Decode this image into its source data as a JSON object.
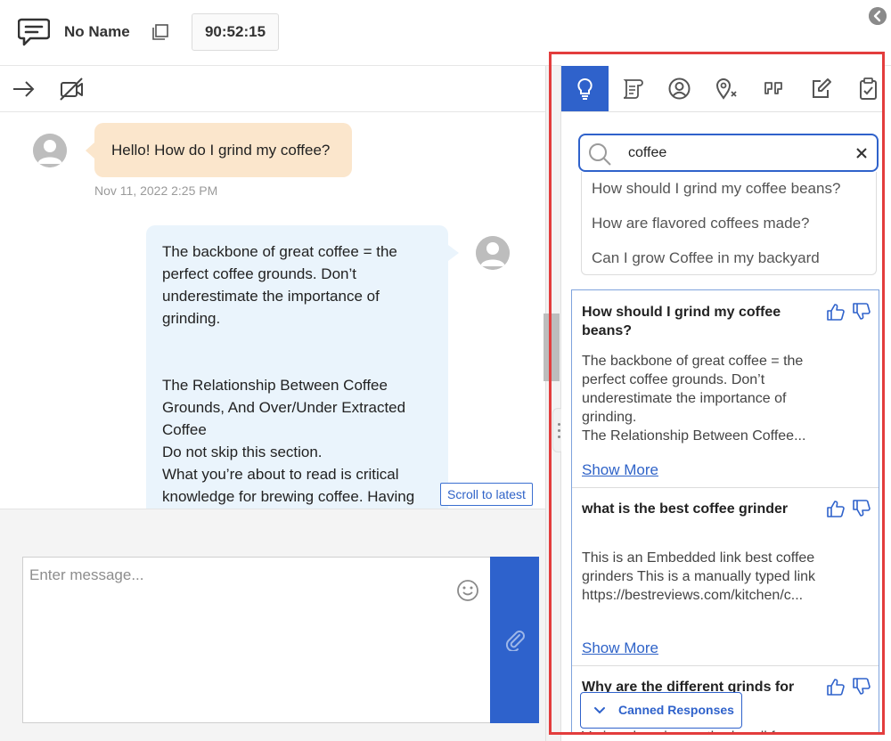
{
  "header": {
    "contact_name": "No Name",
    "timer": "90:52:15"
  },
  "chat": {
    "messages": [
      {
        "direction": "incoming",
        "text": "Hello! How do I grind my coffee?",
        "timestamp": "Nov 11, 2022 2:25 PM"
      },
      {
        "direction": "outgoing",
        "paragraphs": [
          "The backbone of great coffee = the perfect coffee grounds. Don’t underestimate the importance of grinding.",
          "The Relationship Between Coffee Grounds, And Over/Under Extracted Coffee",
          "Do not skip this section.",
          "What you’re about to read is critical knowledge for brewing coffee. Having"
        ]
      }
    ],
    "scroll_to_latest": "Scroll to latest"
  },
  "composer": {
    "placeholder": "Enter message..."
  },
  "panel": {
    "tabs": [
      "lightbulb-icon",
      "script-icon",
      "user-circle-icon",
      "map-pin-icon",
      "quote-icon",
      "edit-icon",
      "clipboard-icon"
    ],
    "search": {
      "value": "coffee"
    },
    "suggestions": [
      "How should I grind my coffee beans?",
      "How are flavored coffees made?",
      "Can I grow Coffee in my backyard"
    ],
    "results": [
      {
        "title": "How should I grind my coffee beans?",
        "body": "The backbone of great coffee = the perfect coffee grounds. Don’t underestimate the importance of grinding.",
        "body_tail": "The Relationship Between Coffee...",
        "show_more": "Show More"
      },
      {
        "title": "what is the best coffee grinder",
        "body": "This is an Embedded link best coffee grinders This is a manually typed link",
        "body_tail": "https://bestreviews.com/kitchen/c...",
        "show_more": "Show More"
      },
      {
        "title": "Why are the different grinds for",
        "body": "Various brewing methods call for"
      }
    ],
    "canned_responses": "Canned Responses"
  },
  "colors": {
    "accent": "#2f62cb",
    "incoming_bubble": "#fbe6cc",
    "outgoing_bubble": "#eaf4fc",
    "highlight_frame": "#e33d3d"
  }
}
